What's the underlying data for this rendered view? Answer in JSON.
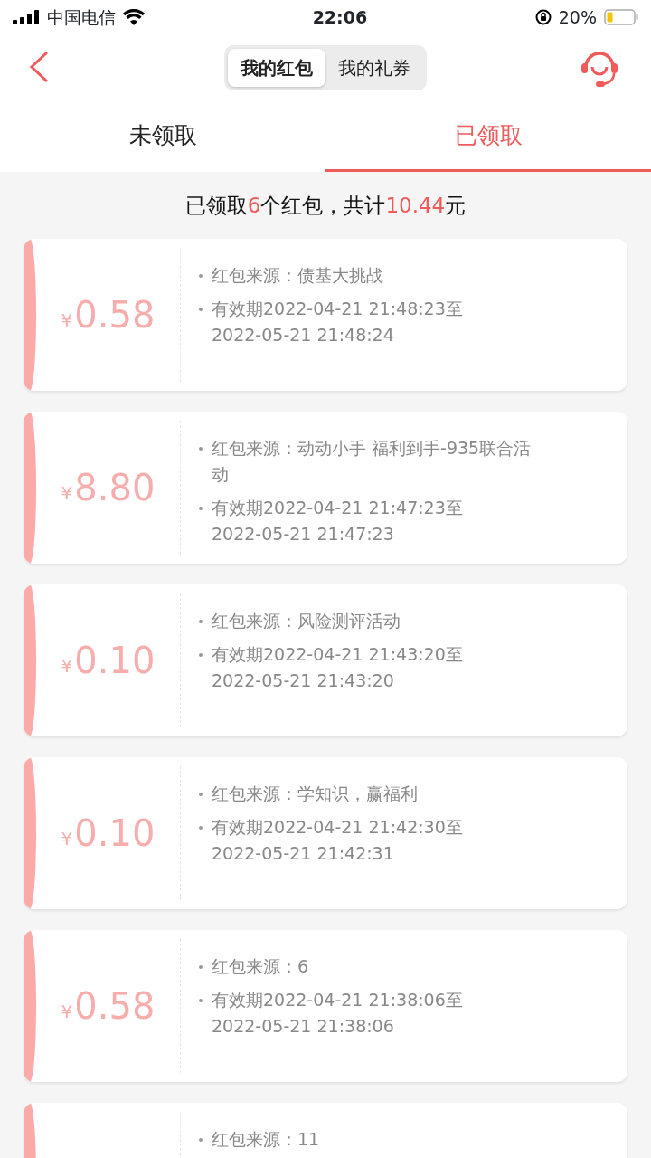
{
  "status_bar": {
    "carrier": "中国电信",
    "time": "22:06",
    "battery": "20%"
  },
  "header": {
    "segments": [
      {
        "label": "我的红包",
        "selected": true
      },
      {
        "label": "我的礼券",
        "selected": false
      }
    ]
  },
  "tabs": [
    {
      "label": "未领取",
      "selected": false
    },
    {
      "label": "已领取",
      "selected": true
    }
  ],
  "summary": "已领取**6**个红包，共计**10.44**元",
  "packets": [
    {
      "currency": "¥",
      "amount": "0.58",
      "source": "红包来源：债基大挑战",
      "validity": "有效期2022-04-21 21:48:23至2022-05-21 21:48:24"
    },
    {
      "currency": "¥",
      "amount": "8.80",
      "source": "红包来源：动动小手 福利到手-935联合活动",
      "validity": "有效期2022-04-21 21:47:23至2022-05-21 21:47:23"
    },
    {
      "currency": "¥",
      "amount": "0.10",
      "source": "红包来源：风险测评活动",
      "validity": "有效期2022-04-21 21:43:20至2022-05-21 21:43:20"
    },
    {
      "currency": "¥",
      "amount": "0.10",
      "source": "红包来源：学知识，赢福利",
      "validity": "有效期2022-04-21 21:42:30至2022-05-21 21:42:31"
    },
    {
      "currency": "¥",
      "amount": "0.58",
      "source": "红包来源：6",
      "validity": "有效期2022-04-21 21:38:06至2022-05-21 21:38:06"
    },
    {
      "source": "红包来源：11"
    }
  ]
}
